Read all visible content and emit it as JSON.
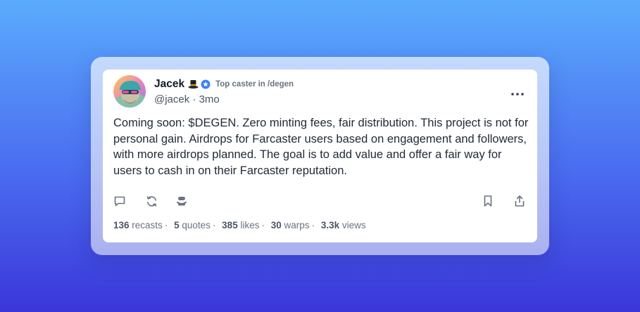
{
  "post": {
    "author": {
      "display_name": "Jacek",
      "handle": "@jacek",
      "badge_text": "Top caster in /degen",
      "icons": [
        "top-hat-icon",
        "verified-icon"
      ]
    },
    "separator": "·",
    "timestamp": "3mo",
    "text": "Coming soon: $DEGEN. Zero minting fees, fair distribution. This project is not for personal gain. Airdrops for Farcaster users based on engagement and followers, with more airdrops planned. The goal is to add value and offer a fair way for users to cash in on their Farcaster reputation.",
    "actions": [
      "comment-icon",
      "recast-icon",
      "quote-icon",
      "bookmark-icon",
      "share-icon"
    ],
    "stats": {
      "recasts_count": "136",
      "recasts_label": "recasts",
      "quotes_count": "5",
      "quotes_label": "quotes",
      "likes_count": "385",
      "likes_label": "likes",
      "warps_count": "30",
      "warps_label": "warps",
      "views_count": "3.3k",
      "views_label": "views"
    }
  },
  "colors": {
    "background_top": "#5aabfd",
    "background_bottom": "#3a36d8",
    "frame": "#b8c6f6",
    "card": "#ffffff",
    "verified": "#3b82f6",
    "text_primary": "#111827",
    "text_secondary": "#6b7280"
  }
}
